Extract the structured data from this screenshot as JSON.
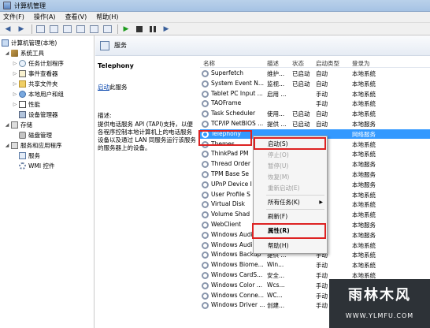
{
  "window": {
    "title": "计算机管理"
  },
  "menu": [
    "文件(F)",
    "操作(A)",
    "查看(V)",
    "帮助(H)"
  ],
  "tree": {
    "root": "计算机管理(本地)",
    "items": [
      {
        "label": "系统工具",
        "icon": "toolbox-icon"
      },
      {
        "label": "任务计划程序",
        "icon": "clock-icon"
      },
      {
        "label": "事件查看器",
        "icon": "event-log-icon"
      },
      {
        "label": "共享文件夹",
        "icon": "folder-icon"
      },
      {
        "label": "本地用户和组",
        "icon": "users-icon"
      },
      {
        "label": "性能",
        "icon": "performance-icon"
      },
      {
        "label": "设备管理器",
        "icon": "device-manager-icon"
      },
      {
        "label": "存储",
        "icon": "storage-icon"
      },
      {
        "label": "磁盘管理",
        "icon": "disk-icon"
      },
      {
        "label": "服务和应用程序",
        "icon": "services-apps-icon"
      },
      {
        "label": "服务",
        "icon": "services-icon"
      },
      {
        "label": "WMI 控件",
        "icon": "wmi-icon"
      }
    ]
  },
  "middle": {
    "header": "服务"
  },
  "details": {
    "service_name": "Telephony",
    "start_link": "启动",
    "start_suffix": "此服务",
    "desc_label": "描述:",
    "description": "提供电话服务 API (TAPI)支持，以便各程序控制本地计算机上的电话服务设备以及通过 LAN 同服务运行该服务的服务器上的设备。"
  },
  "list": {
    "columns": [
      "名称",
      "描述",
      "状态",
      "启动类型",
      "登录为"
    ],
    "rows": [
      [
        "Superfetch",
        "维护...",
        "已启动",
        "自动",
        "本地系统"
      ],
      [
        "System Event N...",
        "监视...",
        "已启动",
        "自动",
        "本地系统"
      ],
      [
        "Tablet PC Input ...",
        "启用 ...",
        "",
        "手动",
        "本地系统"
      ],
      [
        "TAOFrame",
        "",
        "",
        "手动",
        "本地系统"
      ],
      [
        "Task Scheduler",
        "使用...",
        "已启动",
        "自动",
        "本地系统"
      ],
      [
        "TCP/IP NetBIOS ...",
        "提供 ...",
        "已启动",
        "自动",
        "本地服务"
      ],
      [
        "Telephony",
        "",
        "",
        "",
        "网络服务"
      ],
      [
        "Themes",
        "",
        "",
        "",
        "本地系统"
      ],
      [
        "ThinkPad PM",
        "",
        "",
        "",
        "本地系统"
      ],
      [
        "Thread Order",
        "",
        "",
        "",
        "本地服务"
      ],
      [
        "TPM Base Se",
        "",
        "",
        "",
        "本地服务"
      ],
      [
        "UPnP Device I",
        "",
        "",
        "",
        "本地服务"
      ],
      [
        "User Profile S",
        "",
        "",
        "",
        "本地系统"
      ],
      [
        "Virtual Disk",
        "",
        "",
        "",
        "本地系统"
      ],
      [
        "Volume Shad",
        "",
        "",
        "",
        "本地系统"
      ],
      [
        "WebClient",
        "",
        "",
        "",
        "本地服务"
      ],
      [
        "Windows Audi",
        "",
        "",
        "",
        "本地服务"
      ],
      [
        "Windows Audio",
        "",
        "",
        "",
        "本地系统"
      ],
      [
        "Windows Backup",
        "提供 ...",
        "",
        "手动",
        "本地系统"
      ],
      [
        "Windows Biome...",
        "Win...",
        "",
        "手动",
        "本地系统"
      ],
      [
        "Windows CardS...",
        "安全...",
        "",
        "手动",
        "本地系统"
      ],
      [
        "Windows Color ...",
        "Wcs...",
        "",
        "手动",
        "本地服务"
      ],
      [
        "Windows Conne...",
        "WC...",
        "",
        "手动",
        "本地服务"
      ],
      [
        "Windows Driver ...",
        "创建...",
        "",
        "手动",
        "本地系统"
      ]
    ]
  },
  "context_menu": {
    "items": [
      {
        "label": "启动(S)",
        "disabled": false
      },
      {
        "label": "停止(O)",
        "disabled": true
      },
      {
        "label": "暂停(U)",
        "disabled": true
      },
      {
        "label": "恢复(M)",
        "disabled": true
      },
      {
        "label": "重新启动(E)",
        "disabled": true
      },
      {
        "label": "所有任务(K)",
        "disabled": false,
        "submenu": true
      },
      {
        "label": "刷新(F)",
        "disabled": false
      },
      {
        "label": "属性(R)",
        "disabled": false,
        "bold": true
      },
      {
        "label": "帮助(H)",
        "disabled": false
      }
    ]
  },
  "watermark": {
    "top": "雨林木风",
    "bottom": "WWW.YLMFU.COM"
  }
}
